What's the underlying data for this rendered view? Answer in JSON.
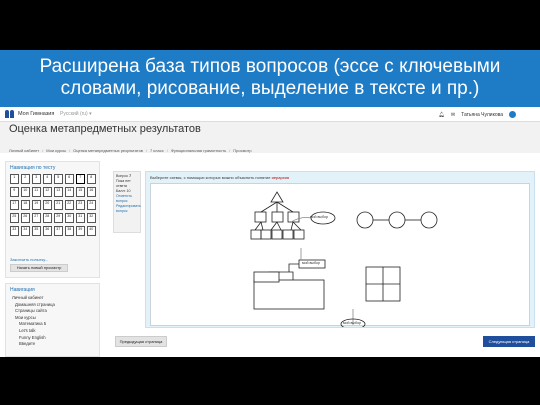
{
  "slide": {
    "heading_line1": "Расширена база типов вопросов (эссе с ключевыми",
    "heading_line2": "словами, рисование, выделение в тексте и пр.)"
  },
  "topbar": {
    "site_name": "Моя Гимназия",
    "language": "Русский (ru) ▾",
    "user_name": "Татьяна Чуликова"
  },
  "page": {
    "title": "Оценка метапредметных результатов"
  },
  "breadcrumbs": [
    "Личный кабинет",
    "Мои курсы",
    "Оценка метапредметных результатов",
    "7 класс",
    "Функциональная грамотность",
    "Просмотр"
  ],
  "quiz_nav": {
    "title": "Навигация по тесту",
    "cells": [
      "1",
      "2",
      "3",
      "4",
      "5",
      "6",
      "7",
      "8",
      "9",
      "10",
      "11",
      "12",
      "13",
      "14",
      "15",
      "16",
      "17",
      "18",
      "19",
      "20",
      "21",
      "22",
      "23",
      "24",
      "25",
      "26",
      "27",
      "28",
      "29",
      "30",
      "31",
      "32",
      "33",
      "34",
      "35",
      "36",
      "37",
      "38",
      "39",
      "40"
    ],
    "current_index": 6,
    "finish_link": "Закончить попытку...",
    "new_attempt": "Начать новый просмотр"
  },
  "navigation": {
    "title": "Навигация",
    "items": [
      "Личный кабинет",
      "Домашняя страница",
      "Страницы сайта",
      "Мои курсы",
      "Математика 5",
      "Let’s talk",
      "Funny English",
      "Введите"
    ]
  },
  "question_info": {
    "label": "Вопрос",
    "number": "7",
    "status": "Пока нет ответа",
    "points": "Балл: 10",
    "flag": "Отметить вопрос",
    "edit": "Редактировать вопрос"
  },
  "question": {
    "prompt": "Выберите схемы, с помощью которых можно объяснить понятие ",
    "keyword": "иерархия",
    "labels": [
      "мой выбор",
      "мой выбор",
      "мой выбор"
    ]
  },
  "buttons": {
    "prev": "Предыдущая страница",
    "next": "Следующая страница"
  },
  "colors": {
    "banner": "#1e7bc6",
    "next_button": "#1f4e9c",
    "panel": "#e3f2f9"
  }
}
